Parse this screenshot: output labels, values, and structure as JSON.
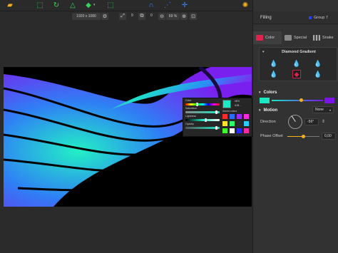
{
  "app": {
    "logo_icon": "folder-logo-icon",
    "settings_icon": "lion-settings-icon"
  },
  "toolbar": {
    "icons": [
      "select-rect-icon",
      "lasso-icon",
      "triangle-icon",
      "tag-icon",
      "crop-icon",
      "magnet-icon",
      "align-icon",
      "move-icon"
    ]
  },
  "subbar": {
    "resolution": "1920 x 1080",
    "gear_icon": "gear-icon",
    "value_a": "9",
    "value_b": "0",
    "zoom_minus": "⊖",
    "zoom": "69 %",
    "zoom_plus": "⊕"
  },
  "panel": {
    "title": "Filling",
    "group_label": "Group 7",
    "group_color": "#2244ff",
    "tabs": [
      {
        "label": "Color",
        "color": "#e0234d"
      },
      {
        "label": "Special",
        "color": "#888888"
      },
      {
        "label": "Snake",
        "color": "#aaaaaa"
      }
    ],
    "gradient_type": "Diamond Gradient",
    "colors_header": "Colors",
    "color_start": "#19e8c1",
    "color_end": "#7a14e8",
    "motion_header": "Motion",
    "motion_mode": "None",
    "direction_label": "Direction",
    "direction_value": "-56°",
    "phase_label": "Phase Offset",
    "phase_value": "0,00"
  },
  "picker": {
    "color_label": "Color",
    "hex_label": "HEX",
    "hex_value": "#1B...",
    "saturation_label": "Saturation",
    "saved_label": "Saved colors",
    "lightness_label": "Lightness",
    "opacity_label": "Opacity",
    "saved_colors": [
      "#ff2a2a",
      "#2a6dff",
      "#9a2aff",
      "#ff2adf",
      "#ffe32a",
      "#2aff6a",
      "#2a2a2a",
      "#2acbff",
      "#3dff2a",
      "#ffffff",
      "#2a2aff",
      "#ff2aa4"
    ]
  }
}
